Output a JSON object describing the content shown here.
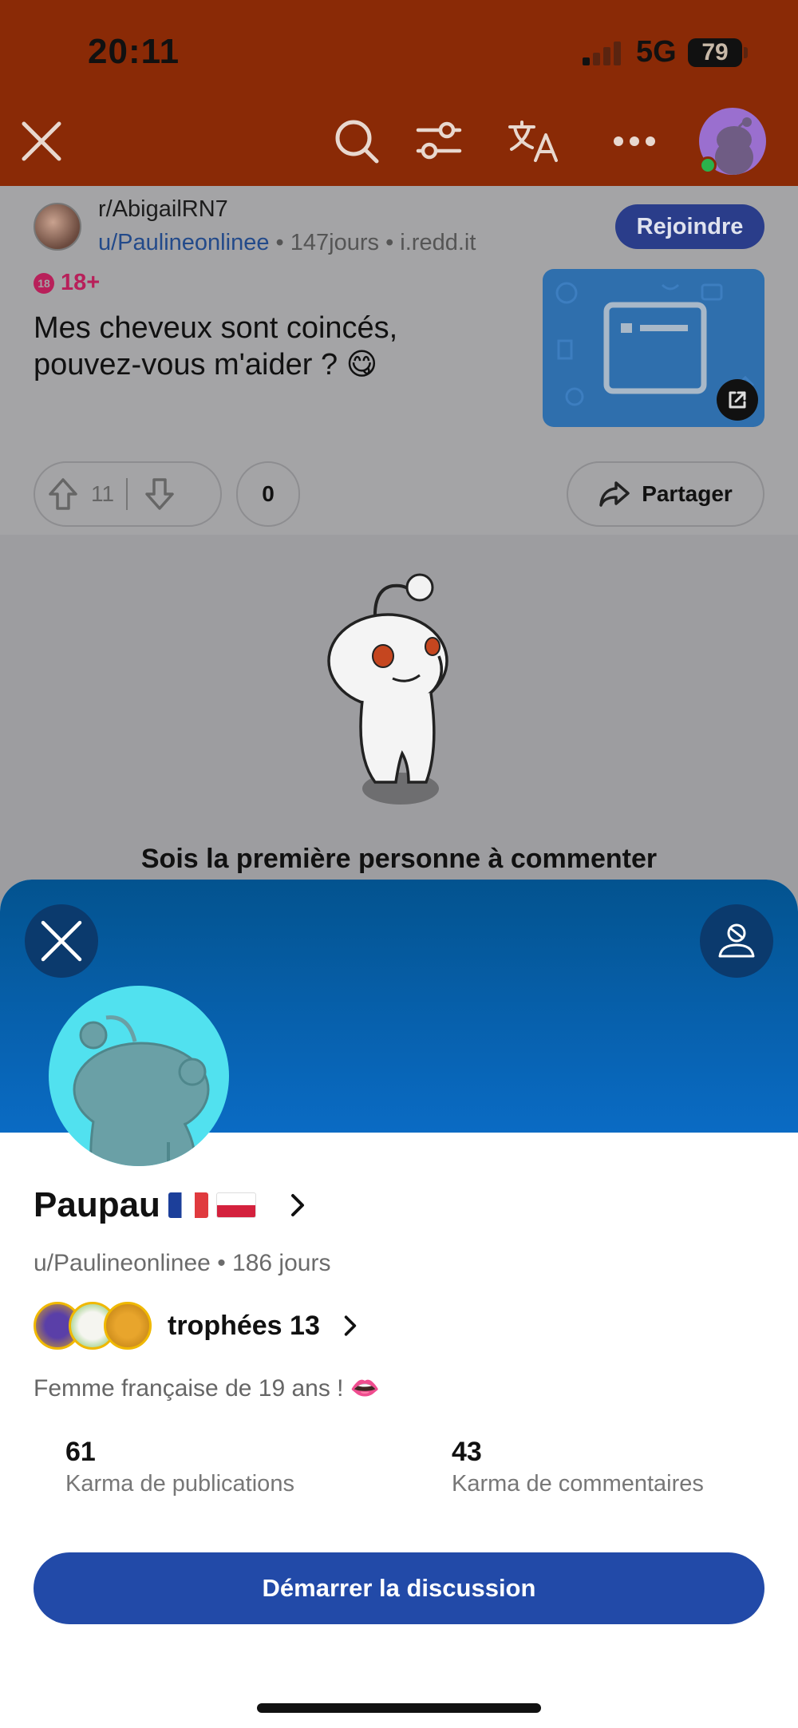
{
  "status_bar": {
    "time": "20:11",
    "network": "5G",
    "battery": "79"
  },
  "header": {
    "icons": [
      "close-icon",
      "search-icon",
      "filter-icon",
      "translate-icon",
      "more-icon",
      "avatar"
    ]
  },
  "post": {
    "subreddit": "r/AbigailRN7",
    "author": "u/Paulineonlinee",
    "age": "147jours",
    "domain": "i.redd.it",
    "join_label": "Rejoindre",
    "nsfw_label": "18+",
    "nsfw_icon_text": "18",
    "title": "Mes cheveux sont coincés, pouvez-vous m'aider ? 😋",
    "upvotes": "11",
    "comments": "0",
    "share_label": "Partager",
    "empty_comments": "Sois la première personne à commenter"
  },
  "profile": {
    "display_name": "Paupau",
    "username": "u/Paulineonlinee",
    "account_age": "186 jours",
    "trophies_label": "trophées 13",
    "bio": "Femme française de 19 ans ! 👄",
    "post_karma": "61",
    "post_karma_label": "Karma de publications",
    "comment_karma": "43",
    "comment_karma_label": "Karma de commentaires",
    "start_chat_label": "Démarrer la discussion"
  },
  "colors": {
    "header_bg": "#8a2a06",
    "join_bg": "#2a3d8a",
    "banner_top": "#03538f",
    "banner_bottom": "#0a6bc4",
    "cta_bg": "#224aa8",
    "nsfw": "#b8205a"
  }
}
